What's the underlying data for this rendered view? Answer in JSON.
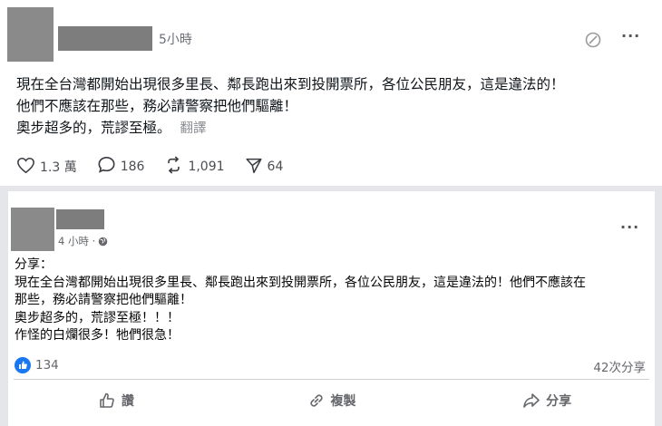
{
  "post1": {
    "time": "5小時",
    "lines": [
      "現在全台灣都開始出現很多里長、鄰長跑出來到投開票所，各位公民朋友，這是違法的！",
      "他們不應該在那些，務必請警察把他們驅離！",
      "奧步超多的，荒謬至極。"
    ],
    "translate": "翻譯",
    "likes": "1.3 萬",
    "replies": "186",
    "reposts": "1,091",
    "shares": "64",
    "icons": [
      "edit-icon",
      "more-icon",
      "heart-icon",
      "comment-icon",
      "repost-icon",
      "send-icon"
    ]
  },
  "post2": {
    "time": "4 小時 ·",
    "lines": [
      "分享：",
      "現在全台灣都開始出現很多里長、鄰長跑出來到投開票所，各位公民朋友，這是違法的！他們不應該在",
      "那些，務必請警察把他們驅離！",
      "奧步超多的，荒謬至極！！！",
      "作怪的白爛很多！牠們很急！"
    ],
    "reactions": "134",
    "shares_count": "42次分享",
    "actions": {
      "like": "讚",
      "copy": "複製",
      "share": "分享"
    },
    "colors": {
      "like_blue": "#1877f2"
    }
  }
}
